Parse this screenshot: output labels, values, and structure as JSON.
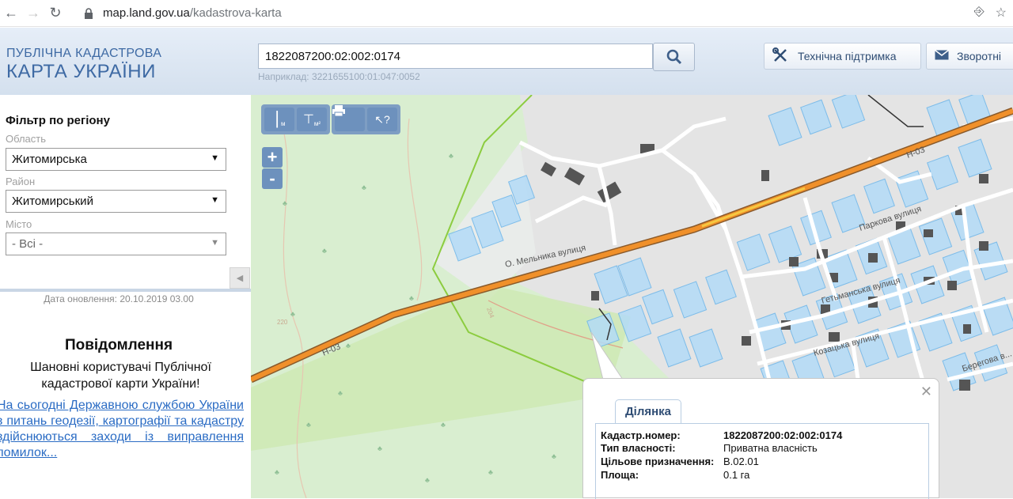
{
  "browser": {
    "url_host": "map.land.gov.ua",
    "url_path": "/kadastrova-karta"
  },
  "header": {
    "logo_line1": "ПУБЛІЧНА КАДАСТРОВА",
    "logo_line2": "КАРТА УКРАЇНИ",
    "search_value": "1822087200:02:002:0174",
    "search_hint": "Наприклад: 3221655100:01:047:0052",
    "support_label": "Технічна підтримка",
    "feedback_label": "Зворотні"
  },
  "sidebar": {
    "filter_title": "Фільтр по регіону",
    "region_label": "Область",
    "region_value": "Житомирська",
    "district_label": "Район",
    "district_value": "Житомирський",
    "city_label": "Місто",
    "city_value": "- Всі -",
    "update_date": "Дата оновлення: 20.10.2019 03.00",
    "notice_title": "Повідомлення",
    "notice_text": "Шановні користувачі Публічної кадастрової карти України!",
    "notice_link": "На сьогодні Державною службою України з питань геодезії, картографії та кадастру здійснюються заходи із виправлення помилок..."
  },
  "map": {
    "tool_ruler_label": "м",
    "tool_area_label": "м²",
    "road_labels": [
      "Н-03",
      "Н-03"
    ],
    "street_labels": [
      "О. Мельника вулиця",
      "Паркова вулиця",
      "Гетьманська вулиця",
      "Козацька вулиця",
      "Берегова в..."
    ],
    "contour_labels": [
      "220",
      "204"
    ]
  },
  "popup": {
    "tab_label": "Ділянка",
    "fields": [
      {
        "key": "Кадастр.номер:",
        "value": "1822087200:02:002:0174"
      },
      {
        "key": "Тип власності:",
        "value": "Приватна власність"
      },
      {
        "key": "Цільове призначення:",
        "value": "В.02.01"
      },
      {
        "key": "Площа:",
        "value": "0.1 га"
      }
    ]
  },
  "colors": {
    "header_text": "#3e6aa4",
    "road": "#f0902a",
    "parcels": "#a8d4f5",
    "buildings": "#555555",
    "link": "#2b6cc4"
  }
}
